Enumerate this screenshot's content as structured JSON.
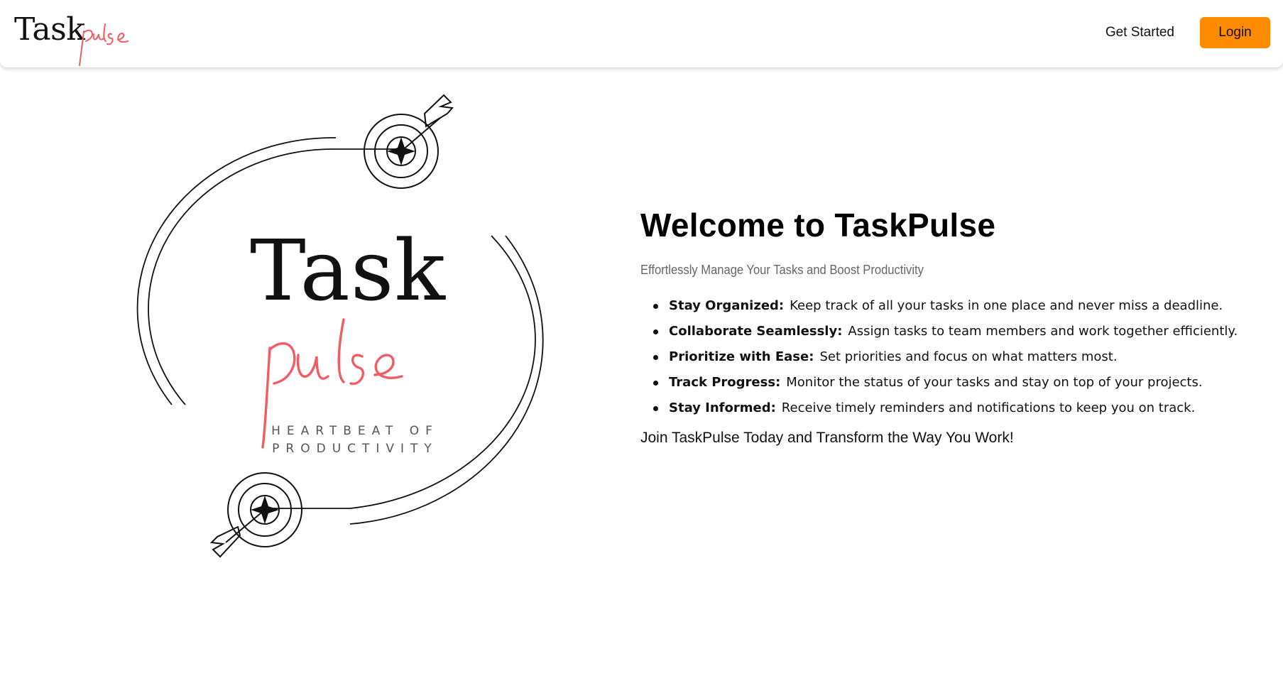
{
  "nav": {
    "logo_word": "Task",
    "logo_script": "pulse",
    "get_started": "Get Started",
    "login": "Login"
  },
  "hero_graphic": {
    "word": "Task",
    "script": "pulse",
    "tagline_line1": "HEARTBEAT OF",
    "tagline_line2": "PRODUCTIVITY"
  },
  "main": {
    "title": "Welcome to TaskPulse",
    "subtitle": "Effortlessly Manage Your Tasks and Boost Productivity",
    "features": [
      {
        "label": "Stay Organized:",
        "text": "Keep track of all your tasks in one place and never miss a deadline."
      },
      {
        "label": "Collaborate Seamlessly:",
        "text": "Assign tasks to team members and work together efficiently."
      },
      {
        "label": "Prioritize with Ease:",
        "text": "Set priorities and focus on what matters most."
      },
      {
        "label": "Track Progress:",
        "text": "Monitor the status of your tasks and stay on top of your projects."
      },
      {
        "label": "Stay Informed:",
        "text": "Receive timely reminders and notifications to keep you on track."
      }
    ],
    "cta": "Join TaskPulse Today and Transform the Way You Work!"
  },
  "colors": {
    "accent": "#ff8c00",
    "script_pink": "#f25c64"
  },
  "icons": [
    "target-arrow-icon"
  ]
}
